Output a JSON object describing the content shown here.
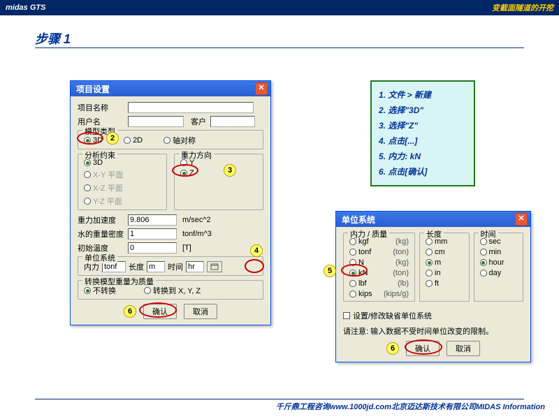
{
  "header": {
    "left": "midas GTS",
    "right": "变截面隧道的开挖"
  },
  "step": "步骤 1",
  "footer": "千斤鼎工程咨询www.1000jd.com北京迈达斯技术有限公司MIDAS Information",
  "notes": [
    "1. 文件 > 新建",
    "2. 选择\"3D\"",
    "3. 选择\"Z\"",
    "4. 点击[...]",
    "5. 内力: kN",
    "6. 点击[确认]"
  ],
  "dialog1": {
    "title": "项目设置",
    "projectName": "项目名称",
    "userName": "用户名",
    "client": "客户",
    "modelType": {
      "label": "模型类型",
      "opts": [
        "3D",
        "2D",
        "轴对称"
      ]
    },
    "analysis": {
      "label": "分析约束",
      "opts": [
        "3D",
        "X-Y 平面",
        "X-Z 平面",
        "Y-Z 平面"
      ]
    },
    "gravity": {
      "label": "重力方向",
      "opts": [
        "Y",
        "Z"
      ]
    },
    "accel": {
      "label": "重力加速度",
      "val": "9.806",
      "unit": "m/sec^2"
    },
    "density": {
      "label": "水的重量密度",
      "val": "1",
      "unit": "tonf/m^3"
    },
    "temp": {
      "label": "初始温度",
      "val": "0",
      "unit": "[T]"
    },
    "units": {
      "label": "单位系统",
      "force": "内力",
      "forceVal": "tonf",
      "length": "长度",
      "lengthVal": "m",
      "time": "时间",
      "timeVal": "hr"
    },
    "convert": {
      "label": "转换模型重量为质量",
      "opts": [
        "不转换",
        "转换到 X, Y, Z"
      ]
    },
    "ok": "确认",
    "cancel": "取消"
  },
  "dialog2": {
    "title": "单位系统",
    "forceLabel": "内力 / 质量",
    "lengthLabel": "长度",
    "timeLabel": "时间",
    "forces": [
      {
        "n": "kgf",
        "p": "(kg)"
      },
      {
        "n": "tonf",
        "p": "(ton)"
      },
      {
        "n": "N",
        "p": "(kg)"
      },
      {
        "n": "kN",
        "p": "(ton)"
      },
      {
        "n": "lbf",
        "p": "(lb)"
      },
      {
        "n": "kips",
        "p": "(kips/g)"
      }
    ],
    "lengths": [
      "mm",
      "cm",
      "m",
      "in",
      "ft"
    ],
    "times": [
      "sec",
      "min",
      "hour",
      "day"
    ],
    "chk": "设置/修改缺省单位系统",
    "note": "请注意: 输入数据不受时间单位改变的限制。",
    "ok": "确认",
    "cancel": "取消"
  }
}
